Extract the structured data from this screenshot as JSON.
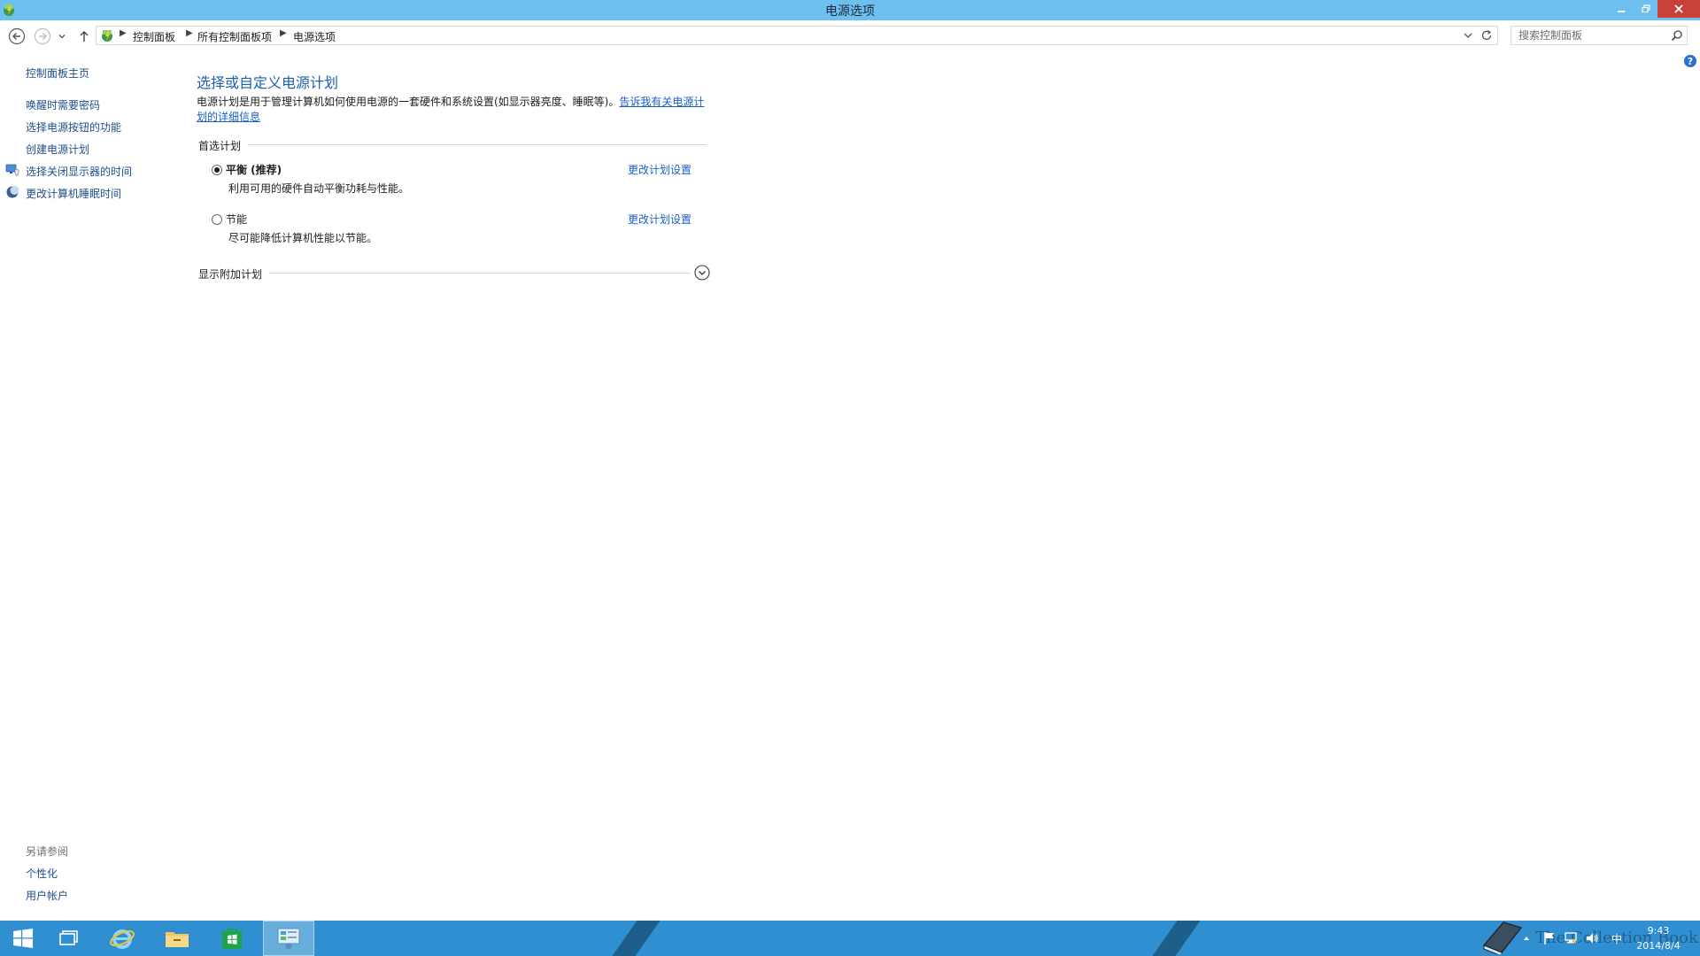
{
  "window": {
    "title": "电源选项"
  },
  "address_bar": {
    "breadcrumbs": [
      "控制面板",
      "所有控制面板项",
      "电源选项"
    ],
    "search_placeholder": "搜索控制面板"
  },
  "sidebar": {
    "home": "控制面板主页",
    "items": [
      {
        "label": "唤醒时需要密码",
        "icon": ""
      },
      {
        "label": "选择电源按钮的功能",
        "icon": ""
      },
      {
        "label": "创建电源计划",
        "icon": ""
      },
      {
        "label": "选择关闭显示器的时间",
        "icon": "monitor-shield-icon"
      },
      {
        "label": "更改计算机睡眠时间",
        "icon": "moon-icon"
      }
    ],
    "see_also": {
      "title": "另请参阅",
      "links": [
        "个性化",
        "用户帐户"
      ]
    }
  },
  "main": {
    "title": "选择或自定义电源计划",
    "description": "电源计划是用于管理计算机如何使用电源的一套硬件和系统设置(如显示器亮度、睡眠等)。",
    "description_link": "告诉我有关电源计划的详细信息",
    "preferred_group": "首选计划",
    "plans": [
      {
        "name": "平衡 (推荐)",
        "description": "利用可用的硬件自动平衡功耗与性能。",
        "link": "更改计划设置",
        "selected": true
      },
      {
        "name": "节能",
        "description": "尽可能降低计算机性能以节能。",
        "link": "更改计划设置",
        "selected": false
      }
    ],
    "additional_plans": "显示附加计划"
  },
  "taskbar": {
    "apps": [
      "start-button",
      "task-view",
      "internet-explorer",
      "file-explorer",
      "store",
      "control-panel"
    ],
    "active_app": "control-panel",
    "clock_time": "9:43",
    "clock_date": "2014/8/4",
    "ime": "中",
    "watermark": "The Collection Book"
  },
  "colors": {
    "titlebar": "#6cbfee",
    "link": "#1a5fc7",
    "heading": "#1f5fae",
    "taskbar": "#2f8fd0",
    "close_button": "#c7403a"
  }
}
